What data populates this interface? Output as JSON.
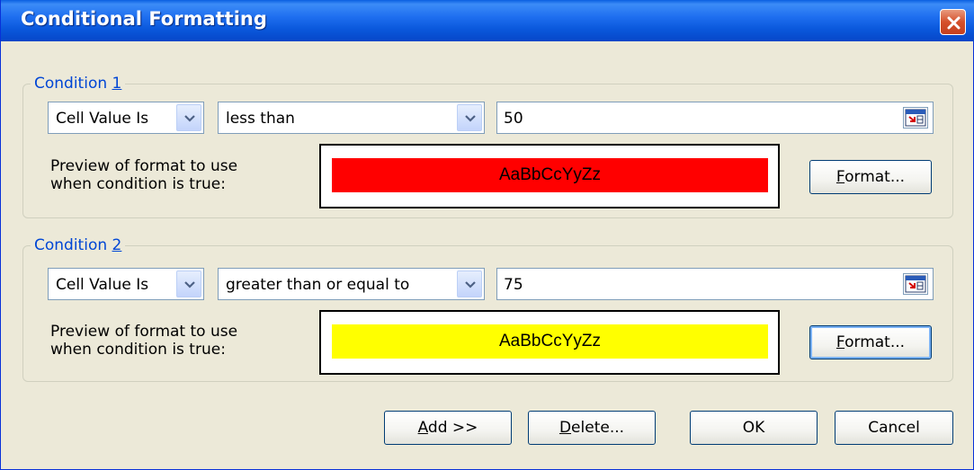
{
  "window": {
    "title": "Conditional Formatting"
  },
  "conditions": [
    {
      "legend_prefix": "Condition ",
      "legend_num": "1",
      "type_value": "Cell Value Is",
      "operator_value": "less than",
      "value": "50",
      "preview_label_line1": "Preview of format to use",
      "preview_label_line2": "when condition is true:",
      "preview_text": "AaBbCcYyZz",
      "preview_color": "#ff0000",
      "format_button_accel": "F",
      "format_button_rest": "ormat..."
    },
    {
      "legend_prefix": "Condition ",
      "legend_num": "2",
      "type_value": "Cell Value Is",
      "operator_value": "greater than or equal to",
      "value": "75",
      "preview_label_line1": "Preview of format to use",
      "preview_label_line2": "when condition is true:",
      "preview_text": "AaBbCcYyZz",
      "preview_color": "#ffff00",
      "format_button_accel": "F",
      "format_button_rest": "ormat..."
    }
  ],
  "buttons": {
    "add_accel": "A",
    "add_rest": "dd >>",
    "delete_accel": "D",
    "delete_rest": "elete...",
    "ok": "OK",
    "cancel": "Cancel"
  },
  "icons": {
    "close": "close-icon",
    "dropdown": "chevron-down-icon",
    "range_select": "collapse-dialog-icon"
  }
}
